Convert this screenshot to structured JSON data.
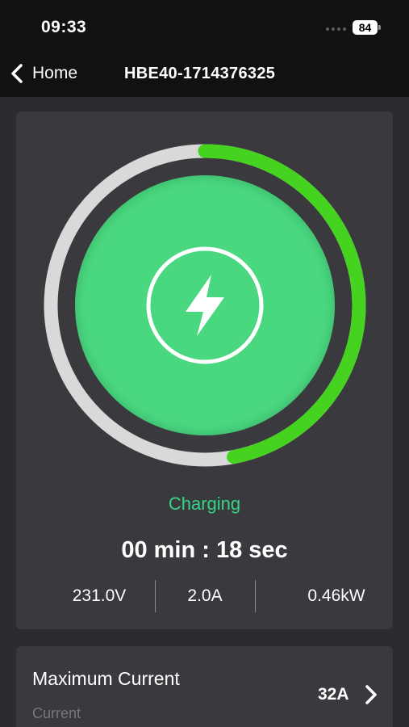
{
  "status_bar": {
    "time": "09:33",
    "battery": "84"
  },
  "nav": {
    "back_label": "Home",
    "title": "HBE40-1714376325"
  },
  "charging": {
    "progress_fraction": 0.47,
    "status": "Charging",
    "timer": "00 min : 18 sec",
    "voltage": "231.0V",
    "current": "2.0A",
    "power": "0.46kW"
  },
  "settings": {
    "max_current": {
      "title": "Maximum Current",
      "subtitle": "Current",
      "value": "32A"
    }
  },
  "colors": {
    "accent_green": "#46d320",
    "core_green": "#4ad880",
    "status_text_green": "#36d586",
    "ring_track": "#d9d9d9"
  }
}
